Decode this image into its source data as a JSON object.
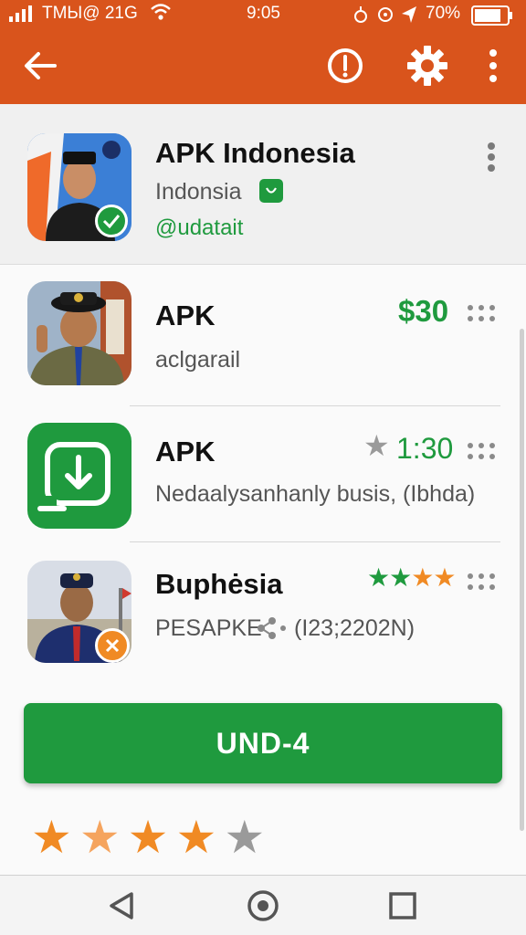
{
  "status_bar": {
    "carrier": "TMЫ@ 21G",
    "time": "9:05",
    "battery": "70%"
  },
  "colors": {
    "accent": "#d9541c",
    "green": "#1f9a3e",
    "star_orange": "#f08a24",
    "star_grey": "#9a9a9a"
  },
  "toolbar": {
    "icons": [
      "back-arrow-icon",
      "info-icon",
      "gear-icon",
      "overflow-menu-icon"
    ]
  },
  "header": {
    "title": "APK Indonesia",
    "subtitle": "Indonsia",
    "handle": "@udatait"
  },
  "items": [
    {
      "title": "APK",
      "meta": "$30",
      "subtitle": "aclgarail"
    },
    {
      "title": "APK",
      "meta": "1:30",
      "subtitle": "Nedaalysanhanly busis, (Ibhda)"
    },
    {
      "title": "Buphėsia",
      "rating": 3.5,
      "subtitle_left": "PESAPKE",
      "subtitle_right": "(I23;2202N)"
    }
  ],
  "cta": {
    "label": "UND-4"
  },
  "rating": {
    "value": 4,
    "max": 5
  },
  "nav_bar": {
    "icons": [
      "back-triangle-icon",
      "home-circle-icon",
      "recents-square-icon"
    ]
  }
}
